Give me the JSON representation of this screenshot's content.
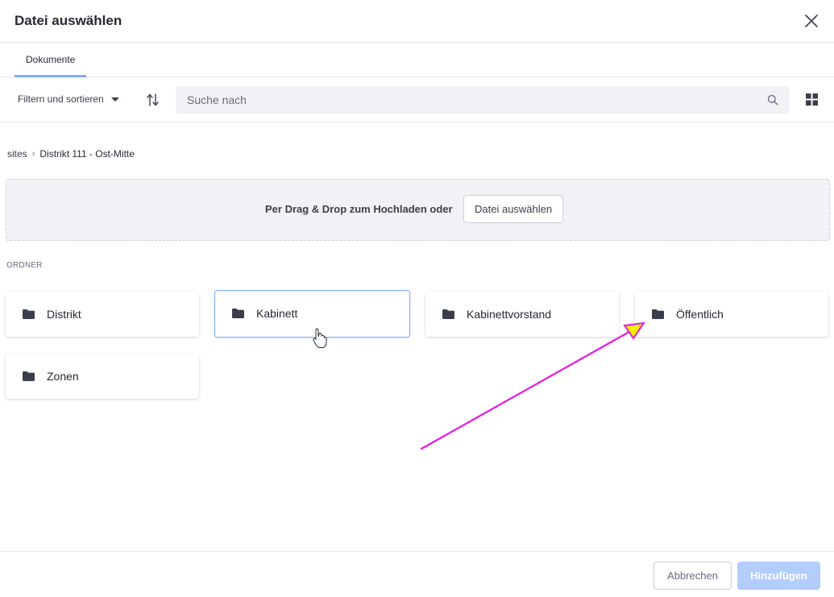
{
  "dialog": {
    "title": "Datei auswählen",
    "close_icon": "close-icon"
  },
  "tabs": [
    {
      "label": "Dokumente",
      "active": true
    }
  ],
  "toolbar": {
    "filter_label": "Filtern und sortieren",
    "sort_icon": "sort-arrows-icon",
    "search_placeholder": "Suche nach",
    "search_value": "",
    "search_icon": "search-icon",
    "view_icon": "grid-view-icon"
  },
  "breadcrumb": [
    {
      "label": "sites"
    },
    {
      "label": "Distrikt 111 - Ost-Mitte"
    }
  ],
  "dropzone": {
    "text": "Per Drag & Drop zum Hochladen oder",
    "button_label": "Datei auswählen"
  },
  "folders_section": {
    "label": "ORDNER",
    "folders": [
      {
        "name": "Distrikt",
        "selected": false
      },
      {
        "name": "Kabinett",
        "selected": true
      },
      {
        "name": "Kabinettvorstand",
        "selected": false
      },
      {
        "name": "Öffentlich",
        "selected": false
      },
      {
        "name": "Zonen",
        "selected": false
      }
    ]
  },
  "footer": {
    "cancel_label": "Abbrechen",
    "add_label": "Hinzufügen",
    "add_enabled": false
  },
  "colors": {
    "accent": "#80acff",
    "primary_disabled": "#b3cdff",
    "annotation_arrow": "#e619e6",
    "annotation_head": "#f0f000"
  }
}
